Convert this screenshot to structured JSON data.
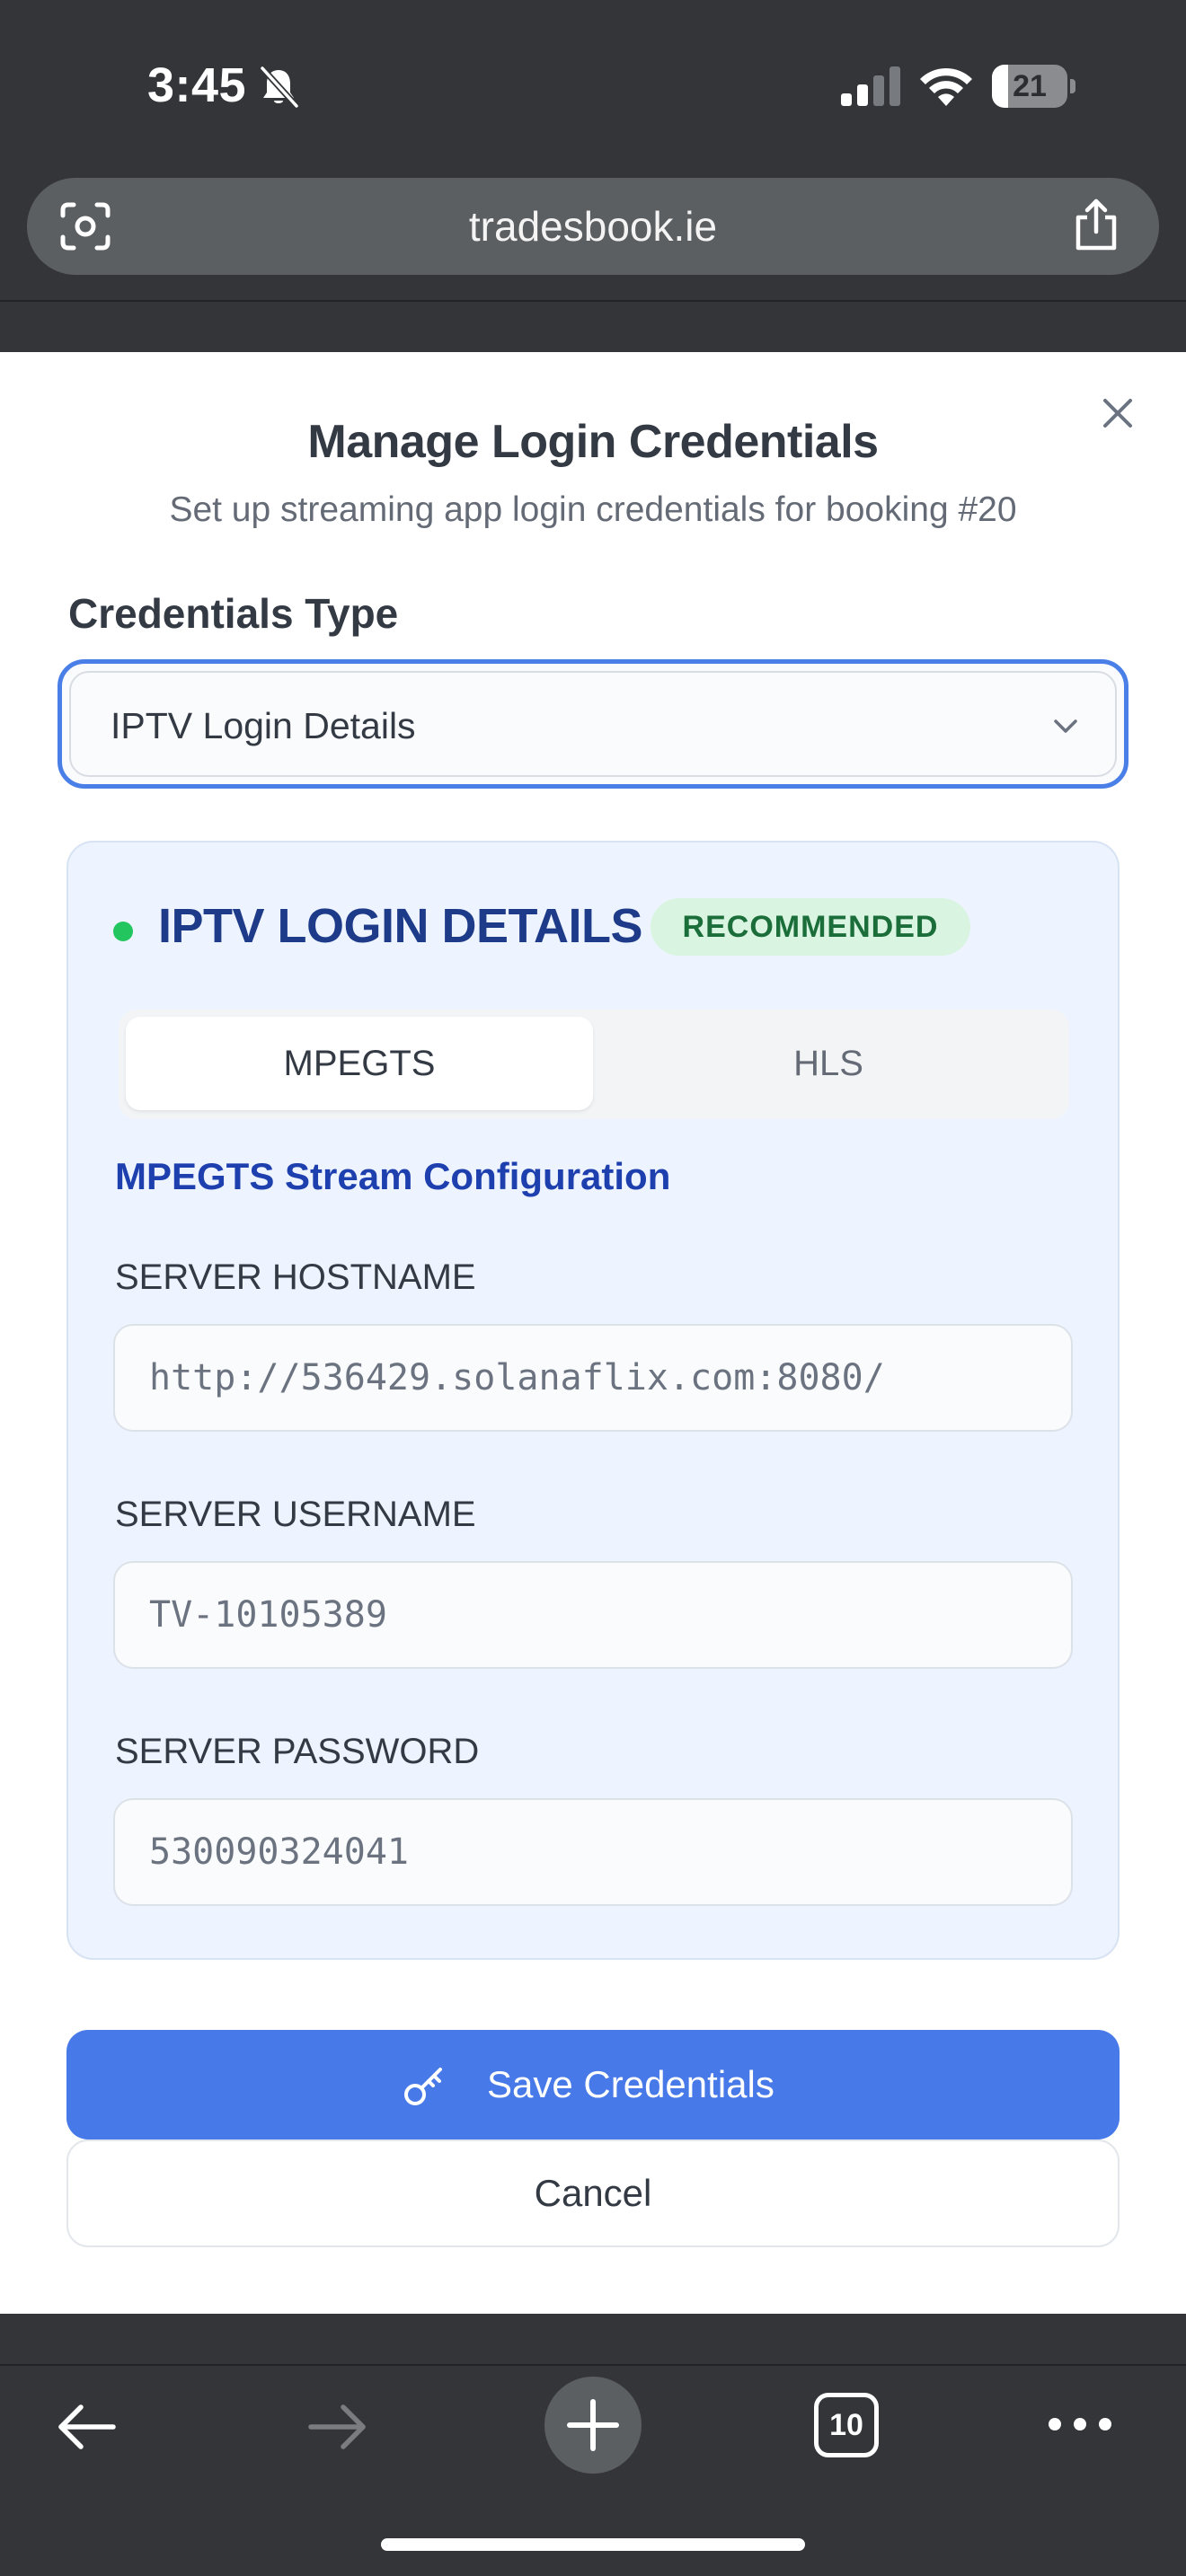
{
  "status_bar": {
    "time": "3:45",
    "battery_level": "21",
    "battery_fraction": 0.21
  },
  "browser": {
    "url": "tradesbook.ie",
    "open_tabs_count": "10"
  },
  "modal": {
    "title": "Manage Login Credentials",
    "subtitle": "Set up streaming app login credentials for booking #20",
    "credentials_type_label": "Credentials Type",
    "credentials_type_value": "IPTV Login Details",
    "panel": {
      "heading": "IPTV LOGIN DETAILS",
      "badge": "RECOMMENDED",
      "tabs": [
        {
          "label": "MPEGTS",
          "active": true
        },
        {
          "label": "HLS",
          "active": false
        }
      ],
      "section_title": "MPEGTS Stream Configuration",
      "fields": [
        {
          "label": "SERVER HOSTNAME",
          "value": "http://536429.solanaflix.com:8080/"
        },
        {
          "label": "SERVER USERNAME",
          "value": "TV-10105389"
        },
        {
          "label": "SERVER PASSWORD",
          "value": "530090324041"
        }
      ]
    },
    "save_label": "Save Credentials",
    "cancel_label": "Cancel"
  },
  "colors": {
    "accent": "#4779e8",
    "heading_blue": "#1e3b8a",
    "badge_bg": "#d9f5e1",
    "status_dot": "#22c55e"
  },
  "icons": [
    "bell-slash-icon",
    "signal-icon",
    "wifi-icon",
    "battery-icon",
    "screen-capture-icon",
    "share-icon",
    "close-icon",
    "chevron-down-icon",
    "key-icon",
    "back-arrow-icon",
    "forward-arrow-icon",
    "plus-icon",
    "tabs-icon",
    "more-icon"
  ]
}
